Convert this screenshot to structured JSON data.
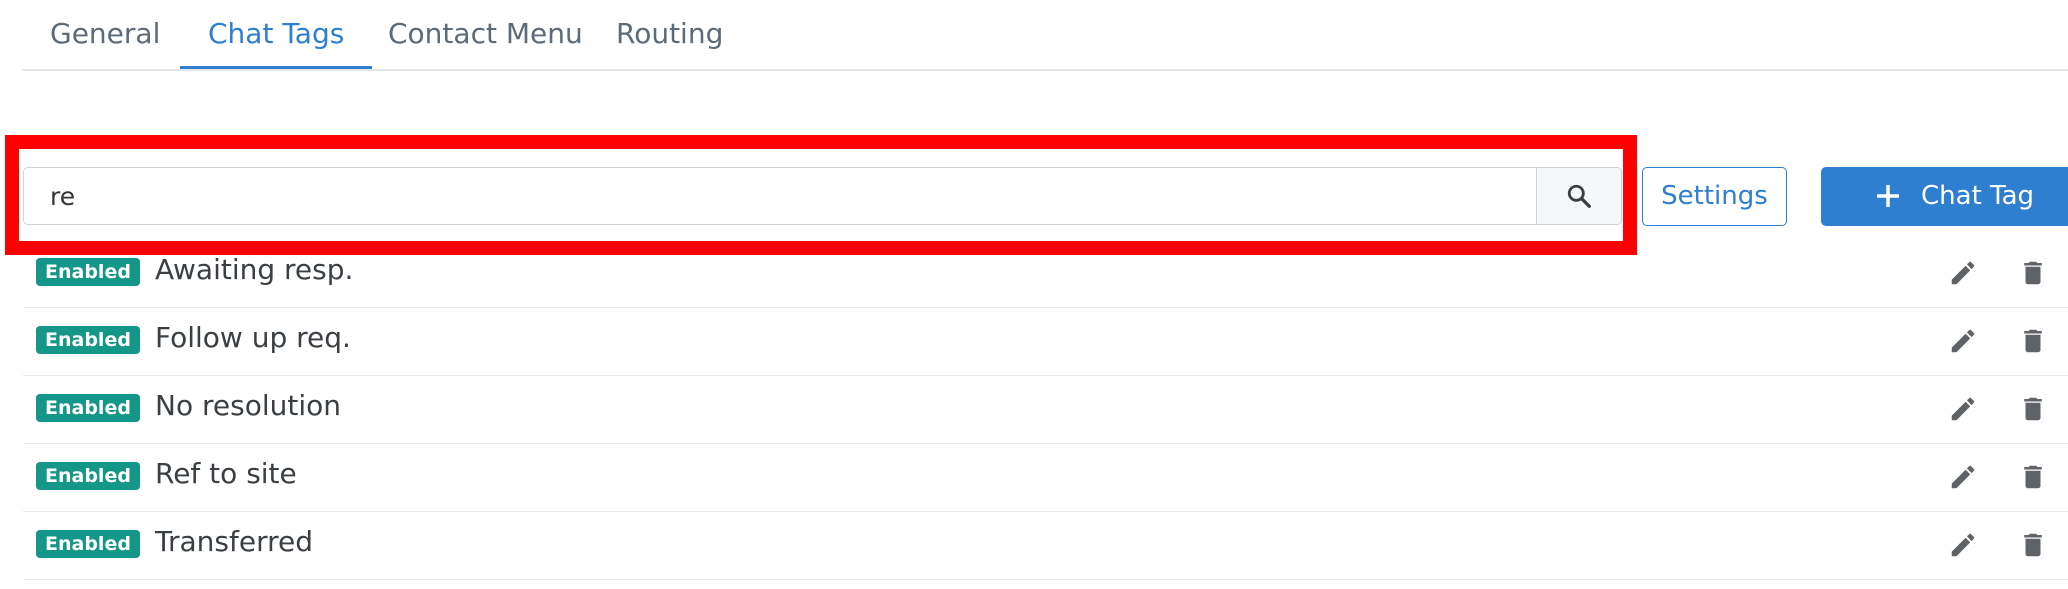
{
  "tabs": [
    {
      "label": "General",
      "active": false
    },
    {
      "label": "Chat Tags",
      "active": true
    },
    {
      "label": "Contact Menu",
      "active": false
    },
    {
      "label": "Routing",
      "active": false
    }
  ],
  "search": {
    "value": "re",
    "icon": "search-icon"
  },
  "toolbar": {
    "settings_label": "Settings",
    "add_label": "Chat Tag",
    "add_icon": "plus-icon"
  },
  "colors": {
    "accent": "#2f7fd0",
    "badge": "#149688",
    "highlight": "#ff0000"
  },
  "tags": [
    {
      "status": "Enabled",
      "name": "Awaiting resp."
    },
    {
      "status": "Enabled",
      "name": "Follow up req."
    },
    {
      "status": "Enabled",
      "name": "No resolution"
    },
    {
      "status": "Enabled",
      "name": "Ref to site"
    },
    {
      "status": "Enabled",
      "name": "Transferred"
    }
  ]
}
